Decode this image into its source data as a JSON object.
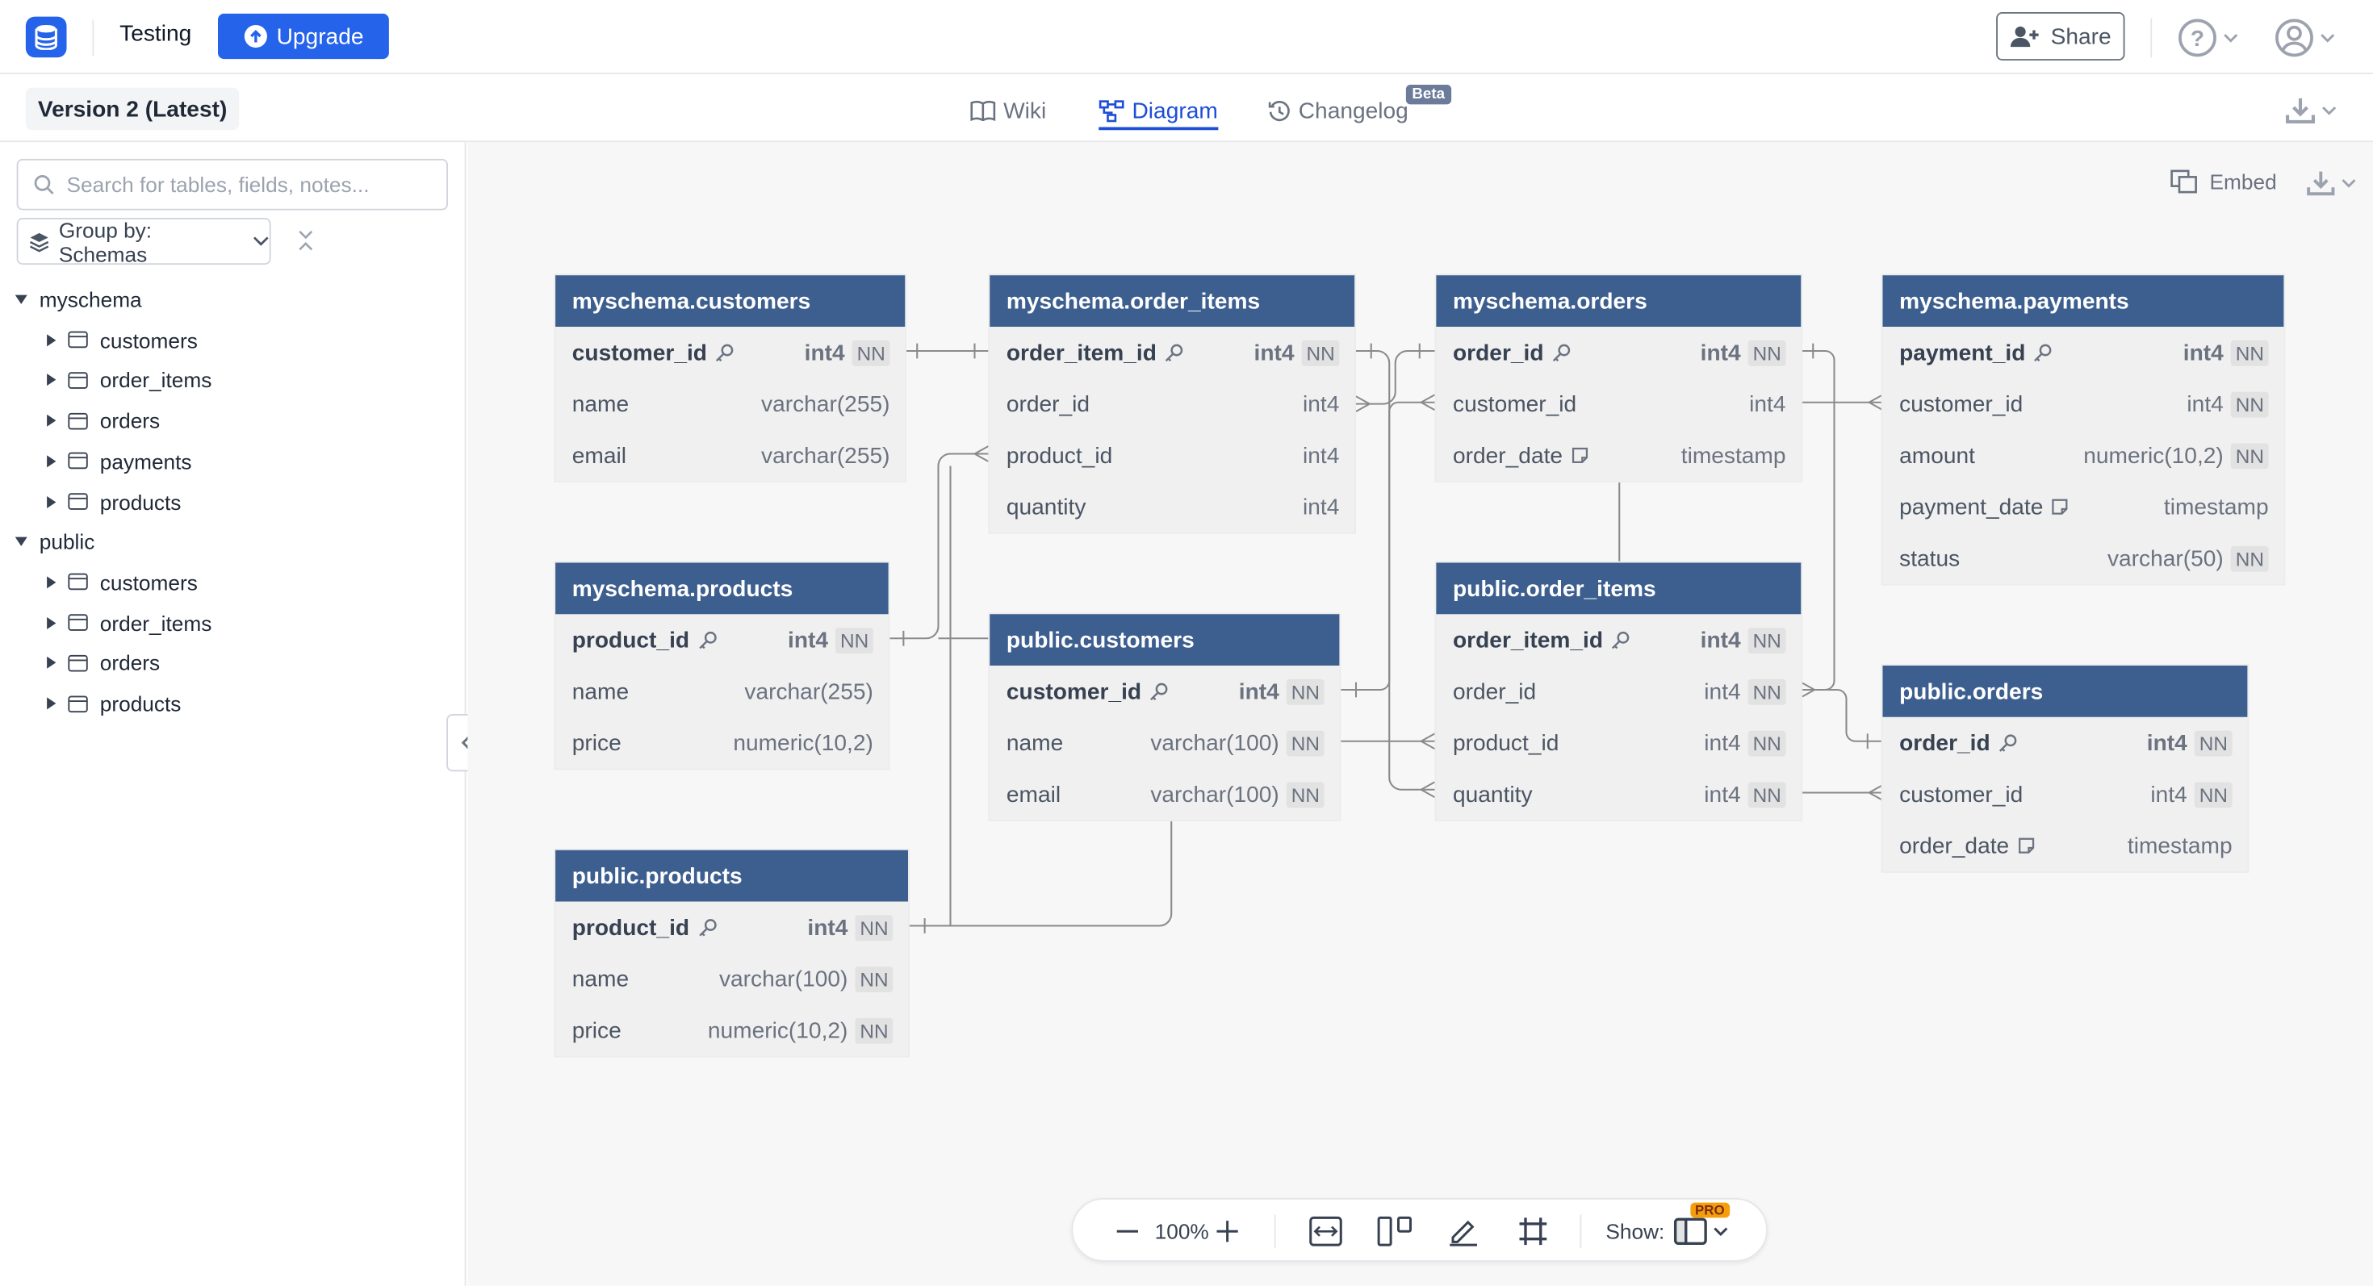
{
  "app": {
    "project_name": "Testing",
    "upgrade_label": "Upgrade",
    "share_label": "Share"
  },
  "subbar": {
    "version_label": "Version 2 (Latest)",
    "tabs": [
      {
        "label": "Wiki",
        "icon": "book-icon"
      },
      {
        "label": "Diagram",
        "icon": "diagram-icon",
        "active": true
      },
      {
        "label": "Changelog",
        "icon": "history-icon",
        "badge": "Beta"
      }
    ]
  },
  "sidebar": {
    "search_placeholder": "Search for tables, fields, notes...",
    "group_by_label": "Group by: Schemas",
    "schemas": [
      {
        "name": "myschema",
        "tables": [
          "customers",
          "order_items",
          "orders",
          "payments",
          "products"
        ]
      },
      {
        "name": "public",
        "tables": [
          "customers",
          "order_items",
          "orders",
          "products"
        ]
      }
    ]
  },
  "canvas": {
    "embed_label": "Embed"
  },
  "tables": [
    {
      "name": "myschema.customers",
      "fields": [
        {
          "name": "customer_id",
          "type": "int4",
          "nn": true,
          "pk": true
        },
        {
          "name": "name",
          "type": "varchar(255)"
        },
        {
          "name": "email",
          "type": "varchar(255)"
        }
      ]
    },
    {
      "name": "myschema.order_items",
      "fields": [
        {
          "name": "order_item_id",
          "type": "int4",
          "nn": true,
          "pk": true
        },
        {
          "name": "order_id",
          "type": "int4"
        },
        {
          "name": "product_id",
          "type": "int4"
        },
        {
          "name": "quantity",
          "type": "int4"
        }
      ]
    },
    {
      "name": "myschema.orders",
      "fields": [
        {
          "name": "order_id",
          "type": "int4",
          "nn": true,
          "pk": true
        },
        {
          "name": "customer_id",
          "type": "int4"
        },
        {
          "name": "order_date",
          "type": "timestamp",
          "note": true
        }
      ]
    },
    {
      "name": "myschema.payments",
      "fields": [
        {
          "name": "payment_id",
          "type": "int4",
          "nn": true,
          "pk": true
        },
        {
          "name": "customer_id",
          "type": "int4",
          "nn": true
        },
        {
          "name": "amount",
          "type": "numeric(10,2)",
          "nn": true
        },
        {
          "name": "payment_date",
          "type": "timestamp",
          "note": true
        },
        {
          "name": "status",
          "type": "varchar(50)",
          "nn": true
        }
      ]
    },
    {
      "name": "myschema.products",
      "fields": [
        {
          "name": "product_id",
          "type": "int4",
          "nn": true,
          "pk": true
        },
        {
          "name": "name",
          "type": "varchar(255)"
        },
        {
          "name": "price",
          "type": "numeric(10,2)"
        }
      ]
    },
    {
      "name": "public.customers",
      "fields": [
        {
          "name": "customer_id",
          "type": "int4",
          "nn": true,
          "pk": true
        },
        {
          "name": "name",
          "type": "varchar(100)",
          "nn": true
        },
        {
          "name": "email",
          "type": "varchar(100)",
          "nn": true
        }
      ]
    },
    {
      "name": "public.order_items",
      "fields": [
        {
          "name": "order_item_id",
          "type": "int4",
          "nn": true,
          "pk": true
        },
        {
          "name": "order_id",
          "type": "int4",
          "nn": true
        },
        {
          "name": "product_id",
          "type": "int4",
          "nn": true
        },
        {
          "name": "quantity",
          "type": "int4",
          "nn": true
        }
      ]
    },
    {
      "name": "public.orders",
      "fields": [
        {
          "name": "order_id",
          "type": "int4",
          "nn": true,
          "pk": true
        },
        {
          "name": "customer_id",
          "type": "int4",
          "nn": true
        },
        {
          "name": "order_date",
          "type": "timestamp",
          "note": true
        }
      ]
    },
    {
      "name": "public.products",
      "fields": [
        {
          "name": "product_id",
          "type": "int4",
          "nn": true,
          "pk": true
        },
        {
          "name": "name",
          "type": "varchar(100)",
          "nn": true
        },
        {
          "name": "price",
          "type": "numeric(10,2)",
          "nn": true
        }
      ]
    }
  ],
  "nn_label": "NN",
  "toolbar": {
    "zoom": "100%",
    "show_label": "Show:",
    "pro_badge": "PRO"
  },
  "colors": {
    "accent": "#2563eb",
    "table_header": "#3d5f8f",
    "table_body": "#f0f0f0",
    "canvas": "#f7f7f8"
  }
}
